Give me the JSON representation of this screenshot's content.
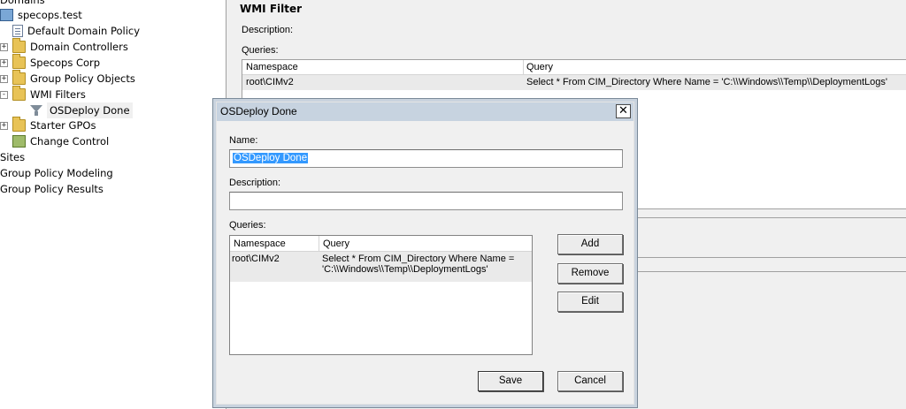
{
  "tree": {
    "items": [
      {
        "label": "Domains",
        "indent": 0,
        "icon": "none",
        "expander": ""
      },
      {
        "label": "specops.test",
        "indent": 1,
        "icon": "domain-icon",
        "expander": ""
      },
      {
        "label": "Default Domain Policy",
        "indent": 2,
        "icon": "gpo-link-icon",
        "expander": ""
      },
      {
        "label": "Domain Controllers",
        "indent": 2,
        "icon": "folder-icon",
        "expander": "+"
      },
      {
        "label": "Specops Corp",
        "indent": 2,
        "icon": "folder-icon",
        "expander": "+"
      },
      {
        "label": "Group Policy Objects",
        "indent": 2,
        "icon": "folder-icon",
        "expander": "+"
      },
      {
        "label": "WMI Filters",
        "indent": 2,
        "icon": "folder-icon",
        "expander": "-"
      },
      {
        "label": "OSDeploy Done",
        "indent": 3,
        "icon": "filter-icon",
        "expander": ""
      },
      {
        "label": "Starter GPOs",
        "indent": 2,
        "icon": "folder-icon",
        "expander": "+"
      },
      {
        "label": "Change Control",
        "indent": 2,
        "icon": "change-control-icon",
        "expander": ""
      },
      {
        "label": "Sites",
        "indent": 0,
        "icon": "none",
        "expander": ""
      },
      {
        "label": "Group Policy Modeling",
        "indent": 0,
        "icon": "none",
        "expander": ""
      },
      {
        "label": "Group Policy Results",
        "indent": 0,
        "icon": "none",
        "expander": ""
      }
    ]
  },
  "pane": {
    "title": "WMI Filter",
    "description_label": "Description:",
    "queries_label": "Queries:",
    "columns": [
      "Namespace",
      "Query"
    ],
    "rows": [
      {
        "namespace": "root\\CIMv2",
        "query": "Select * From CIM_Directory Where Name = 'C:\\\\Windows\\\\Temp\\\\DeploymentLogs'"
      }
    ]
  },
  "dialog": {
    "title": "OSDeploy Done",
    "close_glyph": "✕",
    "name_label": "Name:",
    "name_value": "OSDeploy Done",
    "description_label": "Description:",
    "description_value": "",
    "queries_label": "Queries:",
    "columns": [
      "Namespace",
      "Query"
    ],
    "row": {
      "namespace": "root\\CIMv2",
      "query_line1": "Select * From CIM_Directory Where Name =",
      "query_line2": "'C:\\\\Windows\\\\Temp\\\\DeploymentLogs'"
    },
    "buttons": {
      "add": "Add",
      "remove": "Remove",
      "edit": "Edit",
      "save": "Save",
      "cancel": "Cancel"
    }
  }
}
